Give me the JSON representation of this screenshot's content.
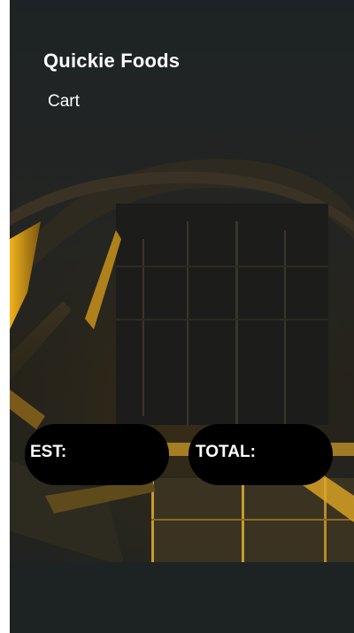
{
  "app": {
    "title": "Quickie Foods",
    "nav_link": "Cart"
  },
  "summary": {
    "est_label": "EST:",
    "est_value": "",
    "total_label": "TOTAL:",
    "total_value": ""
  },
  "colors": {
    "screen_background": "#1e2425",
    "pill_background": "#000000",
    "text": "#ffffff",
    "light_accent": "#e6a616"
  },
  "background_image": "dark building with warm yellow lights"
}
